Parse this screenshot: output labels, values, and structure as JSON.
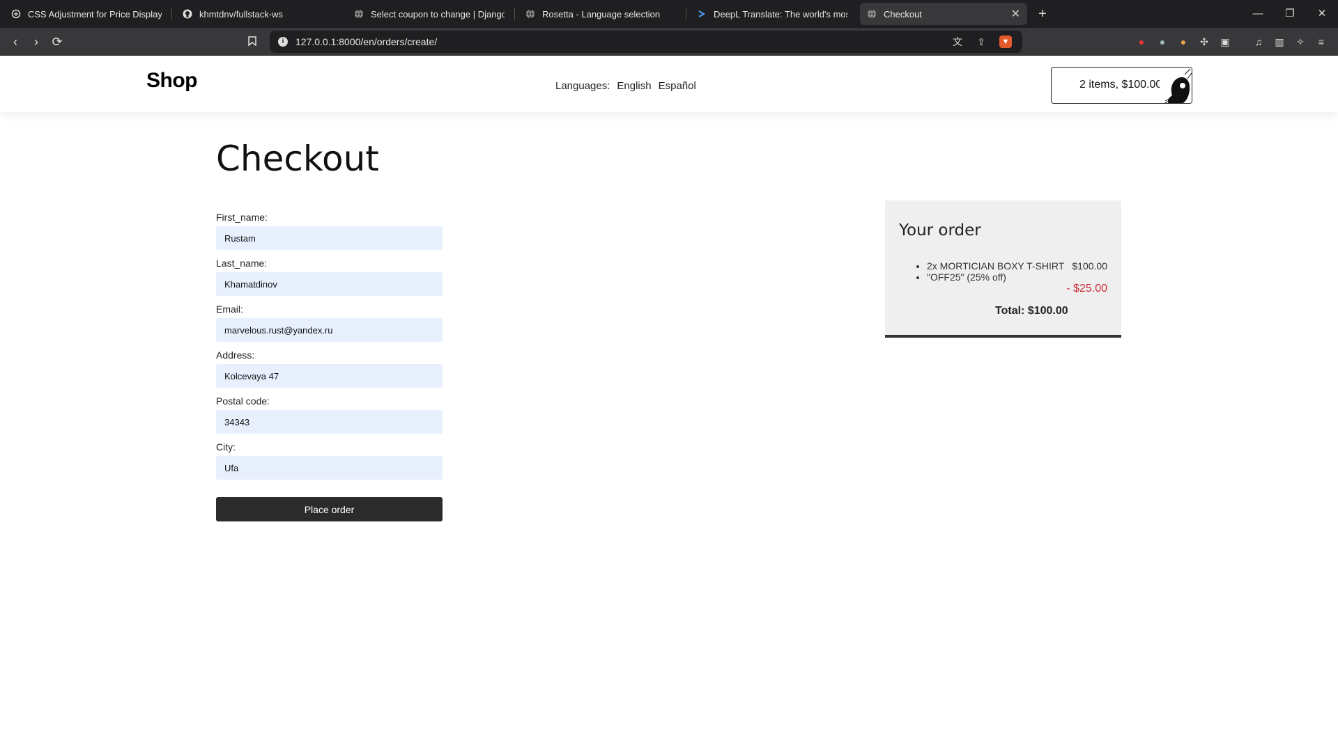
{
  "browser": {
    "tabs": [
      {
        "title": "CSS Adjustment for Price Display - Gi",
        "icon": "openai-icon"
      },
      {
        "title": "khmtdnv/fullstack-ws",
        "icon": "github-icon"
      },
      {
        "title": "Select coupon to change | Django site",
        "icon": "globe-icon"
      },
      {
        "title": "Rosetta - Language selection",
        "icon": "globe-icon"
      },
      {
        "title": "DeepL Translate: The world's most acc",
        "icon": "deepl-icon"
      },
      {
        "title": "Checkout",
        "icon": "globe-icon"
      }
    ],
    "url": "127.0.0.1:8000/en/orders/create/"
  },
  "header": {
    "logo": "Shop",
    "languages_label": "Languages:",
    "languages": [
      "English",
      "Español"
    ],
    "cart": "2 items, $100.00"
  },
  "page": {
    "title": "Checkout"
  },
  "form": {
    "fields": [
      {
        "label": "First_name:",
        "value": "Rustam"
      },
      {
        "label": "Last_name:",
        "value": "Khamatdinov"
      },
      {
        "label": "Email:",
        "value": "marvelous.rust@yandex.ru"
      },
      {
        "label": "Address:",
        "value": "Kolcevaya 47"
      },
      {
        "label": "Postal code:",
        "value": "34343"
      },
      {
        "label": "City:",
        "value": "Ufa"
      }
    ],
    "submit": "Place order"
  },
  "order": {
    "title": "Your order",
    "items": [
      {
        "text": "2x MORTICIAN BOXY T-SHIRT",
        "price": "$100.00"
      }
    ],
    "coupon": "\"OFF25\" (25% off)",
    "discount": "- $25.00",
    "total": "Total: $100.00"
  },
  "colors": {
    "discount": "#cc2a36",
    "button": "#2b2b2b",
    "input_bg": "#e8f0fe",
    "order_bg": "#efefef"
  }
}
